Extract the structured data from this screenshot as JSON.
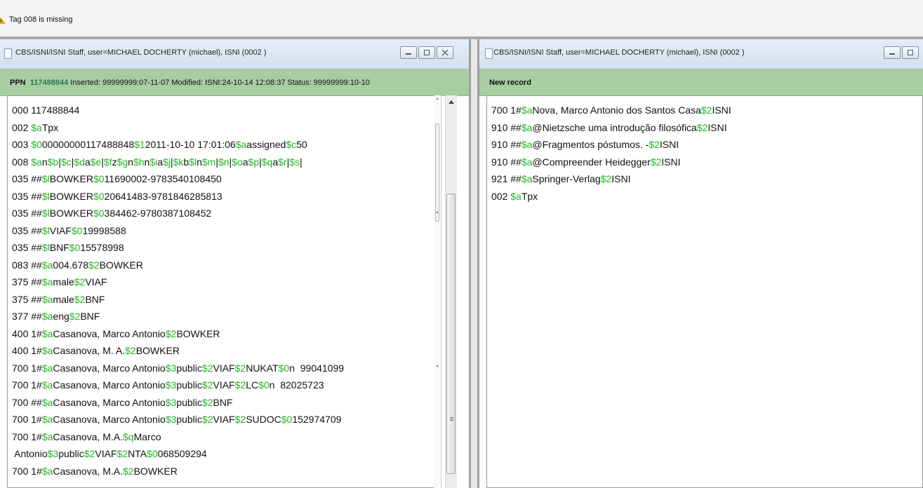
{
  "status": {
    "message": "Tag 008 is missing",
    "icon": "warning-icon"
  },
  "left": {
    "title": "CBS/ISNI/ISNI Staff, user=MICHAEL DOCHERTY (michael), ISNI (0002 )",
    "ppn_label": "PPN",
    "ppn_value": "117488844",
    "meta": " Inserted: 99999999:07-11-07 Modified: ISNI:24-10-14 12:08:37 Status: 99999999:10-10",
    "lines": [
      [
        "000 117488844"
      ],
      [
        "002 ",
        {
          "s": "$a"
        },
        "Tpx"
      ],
      [
        "003 ",
        {
          "s": "$0"
        },
        "00000000117488848",
        {
          "s": "$1"
        },
        "2011-10-10 17:01:06",
        {
          "s": "$a"
        },
        "assigned",
        {
          "s": "$c"
        },
        "50"
      ],
      [
        "008 ",
        {
          "s": "$a"
        },
        "n",
        {
          "s": "$b"
        },
        "|",
        {
          "s": "$c"
        },
        "|",
        {
          "s": "$d"
        },
        "a",
        {
          "s": "$e"
        },
        "|",
        {
          "s": "$f"
        },
        "z",
        {
          "s": "$g"
        },
        "n",
        {
          "s": "$h"
        },
        "n",
        {
          "s": "$i"
        },
        "a",
        {
          "s": "$j"
        },
        "|",
        {
          "s": "$k"
        },
        "b",
        {
          "s": "$l"
        },
        "n",
        {
          "s": "$m"
        },
        "|",
        {
          "s": "$n"
        },
        "|",
        {
          "s": "$o"
        },
        "a",
        {
          "s": "$p"
        },
        "|",
        {
          "s": "$q"
        },
        "a",
        {
          "s": "$r"
        },
        "|",
        {
          "s": "$s"
        },
        "|"
      ],
      [
        "035 ##",
        {
          "s": "$l"
        },
        "BOWKER",
        {
          "s": "$0"
        },
        "11690002-9783540108450"
      ],
      [
        "035 ##",
        {
          "s": "$l"
        },
        "BOWKER",
        {
          "s": "$0"
        },
        "20641483-9781846285813"
      ],
      [
        "035 ##",
        {
          "s": "$l"
        },
        "BOWKER",
        {
          "s": "$0"
        },
        "384462-9780387108452"
      ],
      [
        "035 ##",
        {
          "s": "$l"
        },
        "VIAF",
        {
          "s": "$0"
        },
        "19998588"
      ],
      [
        "035 ##",
        {
          "s": "$l"
        },
        "BNF",
        {
          "s": "$0"
        },
        "15578998"
      ],
      [
        "083 ##",
        {
          "s": "$a"
        },
        "004.678",
        {
          "s": "$2"
        },
        "BOWKER"
      ],
      [
        "375 ##",
        {
          "s": "$a"
        },
        "male",
        {
          "s": "$2"
        },
        "VIAF"
      ],
      [
        "375 ##",
        {
          "s": "$a"
        },
        "male",
        {
          "s": "$2"
        },
        "BNF"
      ],
      [
        "377 ##",
        {
          "s": "$a"
        },
        "eng",
        {
          "s": "$2"
        },
        "BNF"
      ],
      [
        "400 1#",
        {
          "s": "$a"
        },
        "Casanova, Marco Antonio",
        {
          "s": "$2"
        },
        "BOWKER"
      ],
      [
        "400 1#",
        {
          "s": "$a"
        },
        "Casanova, M. A.",
        {
          "s": "$2"
        },
        "BOWKER"
      ],
      [
        "700 1#",
        {
          "s": "$a"
        },
        "Casanova, Marco Antonio",
        {
          "s": "$3"
        },
        "public",
        {
          "s": "$2"
        },
        "VIAF",
        {
          "s": "$2"
        },
        "NUKAT",
        {
          "s": "$0"
        },
        "n  99041099"
      ],
      [
        "700 1#",
        {
          "s": "$a"
        },
        "Casanova, Marco Antonio",
        {
          "s": "$3"
        },
        "public",
        {
          "s": "$2"
        },
        "VIAF",
        {
          "s": "$2"
        },
        "LC",
        {
          "s": "$0"
        },
        "n  82025723"
      ],
      [
        "700 ##",
        {
          "s": "$a"
        },
        "Casanova, Marco Antonio",
        {
          "s": "$3"
        },
        "public",
        {
          "s": "$2"
        },
        "BNF"
      ],
      [
        "700 1#",
        {
          "s": "$a"
        },
        "Casanova, Marco Antonio",
        {
          "s": "$3"
        },
        "public",
        {
          "s": "$2"
        },
        "VIAF",
        {
          "s": "$2"
        },
        "SUDOC",
        {
          "s": "$0"
        },
        "152974709"
      ],
      [
        "700 1#",
        {
          "s": "$a"
        },
        "Casanova, M.A.",
        {
          "s": "$q"
        },
        "Marco"
      ],
      [
        " Antonio",
        {
          "s": "$3"
        },
        "public",
        {
          "s": "$2"
        },
        "VIAF",
        {
          "s": "$2"
        },
        "NTA",
        {
          "s": "$0"
        },
        "068509294"
      ],
      [
        "700 1#",
        {
          "s": "$a"
        },
        "Casanova, M.A.",
        {
          "s": "$2"
        },
        "BOWKER"
      ]
    ]
  },
  "right": {
    "title": "CBS/ISNI/ISNI Staff, user=MICHAEL DOCHERTY (michael), ISNI (0002 )",
    "header": "New record",
    "lines": [
      [
        "700 1#",
        {
          "s": "$a"
        },
        "Nova, Marco Antonio dos Santos Casa",
        {
          "s": "$2"
        },
        "ISNI"
      ],
      [
        "910 ##",
        {
          "s": "$a"
        },
        "@Nietzsche uma introdução filosófica",
        {
          "s": "$2"
        },
        "ISNI"
      ],
      [
        "910 ##",
        {
          "s": "$a"
        },
        "@Fragmentos póstumos. -",
        {
          "s": "$2"
        },
        "ISNI"
      ],
      [
        "910 ##",
        {
          "s": "$a"
        },
        "@Compreender Heidegger",
        {
          "s": "$2"
        },
        "ISNI"
      ],
      [
        "921 ##",
        {
          "s": "$a"
        },
        "Springer-Verlag",
        {
          "s": "$2"
        },
        "ISNI"
      ],
      [
        "002 ",
        {
          "s": "$a"
        },
        "Tpx"
      ]
    ]
  },
  "colors": {
    "subfield": "#23b623",
    "header_band": "#a8cda2",
    "ppn": "#2f7a52"
  }
}
